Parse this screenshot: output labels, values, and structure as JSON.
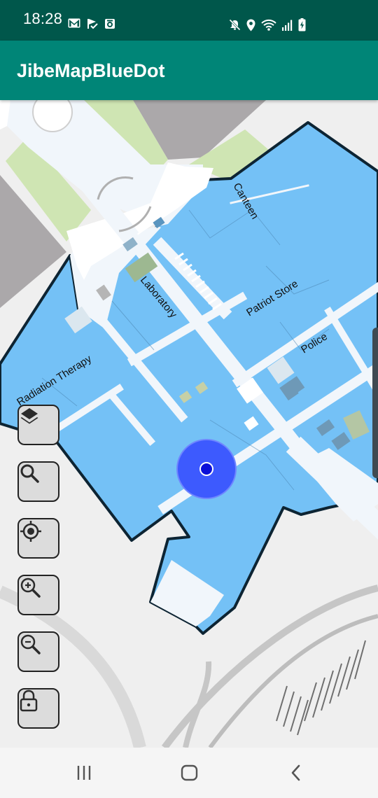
{
  "status_bar": {
    "time": "18:28",
    "left_icons": [
      "gmail-icon",
      "flag-icon",
      "camera-app-icon"
    ],
    "right_icons": [
      "mute-icon",
      "location-icon",
      "wifi-icon",
      "signal-icon",
      "battery-charging-icon"
    ]
  },
  "app_bar": {
    "title": "JibeMapBlueDot"
  },
  "map": {
    "room_labels": {
      "canteen": "Canteen",
      "laboratory": "Laboratory",
      "patriot_store": "Patriot Store",
      "police": "Police",
      "radiation_therapy": "Radiation Therapy"
    },
    "blue_dot": {
      "color": "#2233ff",
      "accuracy_color": "#3d5afe"
    },
    "colors": {
      "room": "#74c1f6",
      "outline": "#0d2433",
      "corridor": "#f1f6fb",
      "park": "#cfe5b3",
      "parking": "#aba8aa",
      "road": "#c9c9c9"
    }
  },
  "controls": [
    {
      "name": "layers-button",
      "icon": "layers-icon"
    },
    {
      "name": "search-button",
      "icon": "search-icon"
    },
    {
      "name": "my-location-button",
      "icon": "locate-icon"
    },
    {
      "name": "zoom-in-button",
      "icon": "zoom-in-icon"
    },
    {
      "name": "zoom-out-button",
      "icon": "zoom-out-icon"
    },
    {
      "name": "lock-button",
      "icon": "lock-icon"
    }
  ],
  "nav_bar": {
    "buttons": [
      "recent-apps",
      "home",
      "back"
    ]
  }
}
